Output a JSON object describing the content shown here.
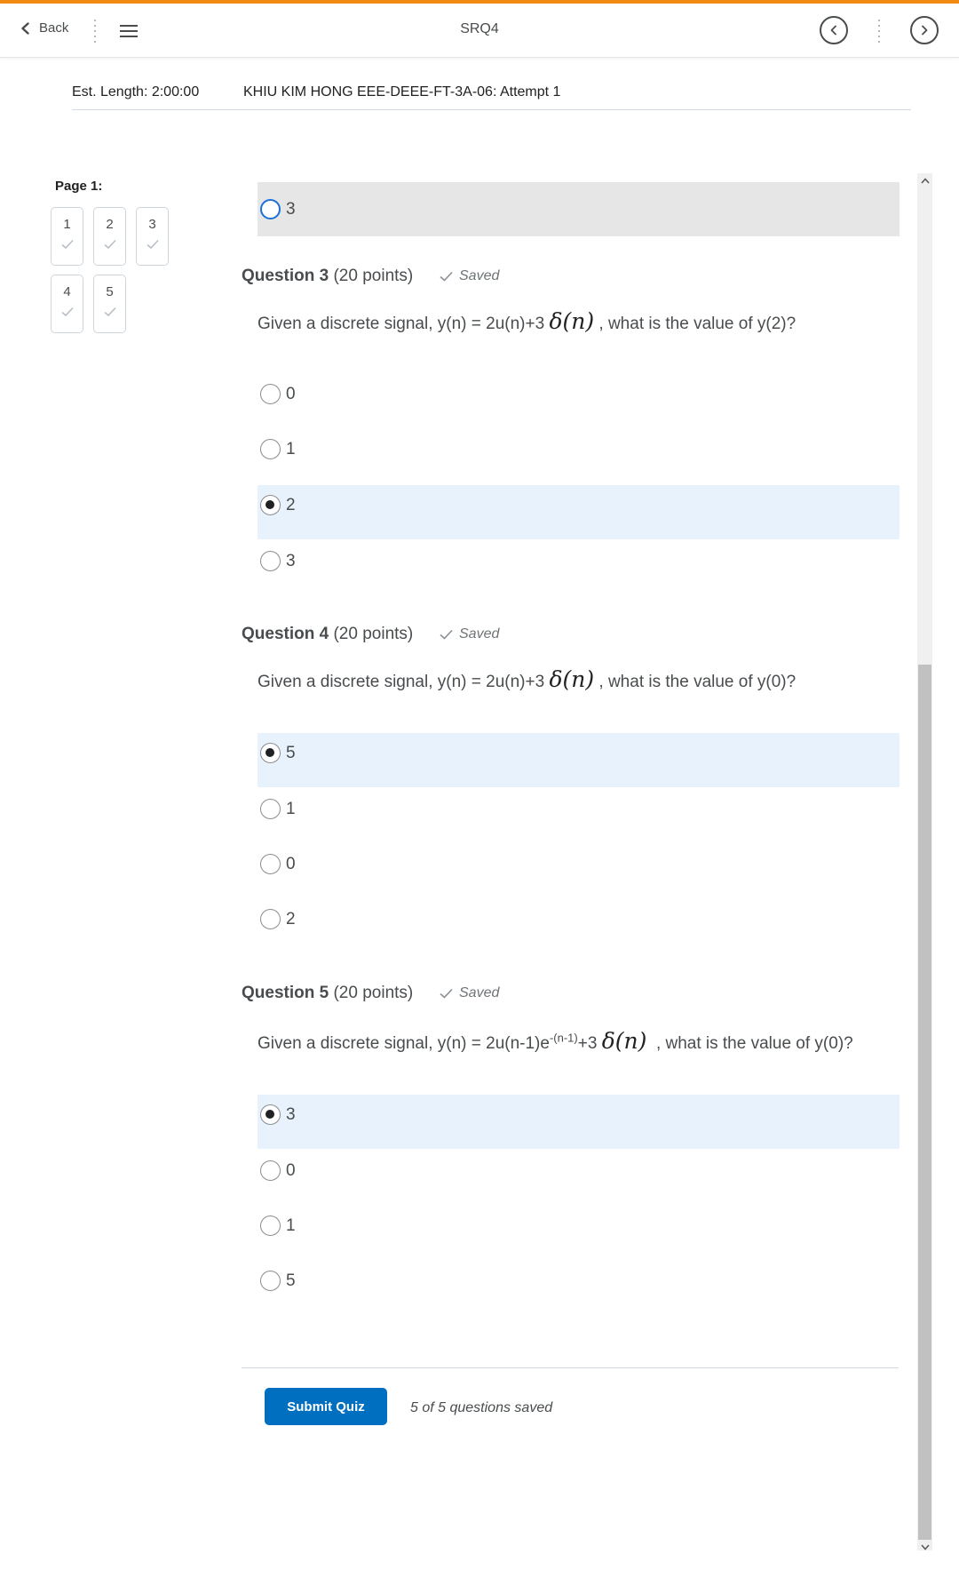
{
  "topbar": {
    "back_label": "Back",
    "title": "SRQ4"
  },
  "header": {
    "est_length": "Est. Length: 2:00:00",
    "attempt": "KHIU KIM HONG EEE-DEEE-FT-3A-06: Attempt 1"
  },
  "page_nav": {
    "label": "Page 1:",
    "questions": [
      "1",
      "2",
      "3",
      "4",
      "5"
    ]
  },
  "prev_question_option": {
    "label": "3"
  },
  "questions": [
    {
      "title": "Question 3",
      "points": "(20 points)",
      "status": "Saved",
      "text_before": "Given a discrete signal, y(n) = 2u(n)+3",
      "delta": "δ(n)",
      "text_after": ", what is the value of y(2)?",
      "options": [
        "0",
        "1",
        "2",
        "3"
      ],
      "selected": "2"
    },
    {
      "title": "Question 4",
      "points": "(20 points)",
      "status": "Saved",
      "text_before": "Given a discrete signal, y(n) = 2u(n)+3",
      "delta": "δ(n)",
      "text_after": ", what is the value of y(0)?",
      "options": [
        "5",
        "1",
        "0",
        "2"
      ],
      "selected": "5"
    },
    {
      "title": "Question 5",
      "points": "(20 points)",
      "status": "Saved",
      "text_before": "Given a discrete signal, y(n) = 2u(n-1)e",
      "sup": "-(n-1)",
      "text_mid": "+3",
      "delta": "δ(n)",
      "text_after": ", what is the value of y(0)?",
      "options": [
        "3",
        "0",
        "1",
        "5"
      ],
      "selected": "3"
    }
  ],
  "footer": {
    "submit_label": "Submit Quiz",
    "saved_status": "5 of 5 questions saved"
  },
  "colors": {
    "accent_bar": "#f18a12",
    "submit_button": "#006fbf",
    "selected_row": "#e8f2fc",
    "focus_ring": "#1e6fd9"
  }
}
